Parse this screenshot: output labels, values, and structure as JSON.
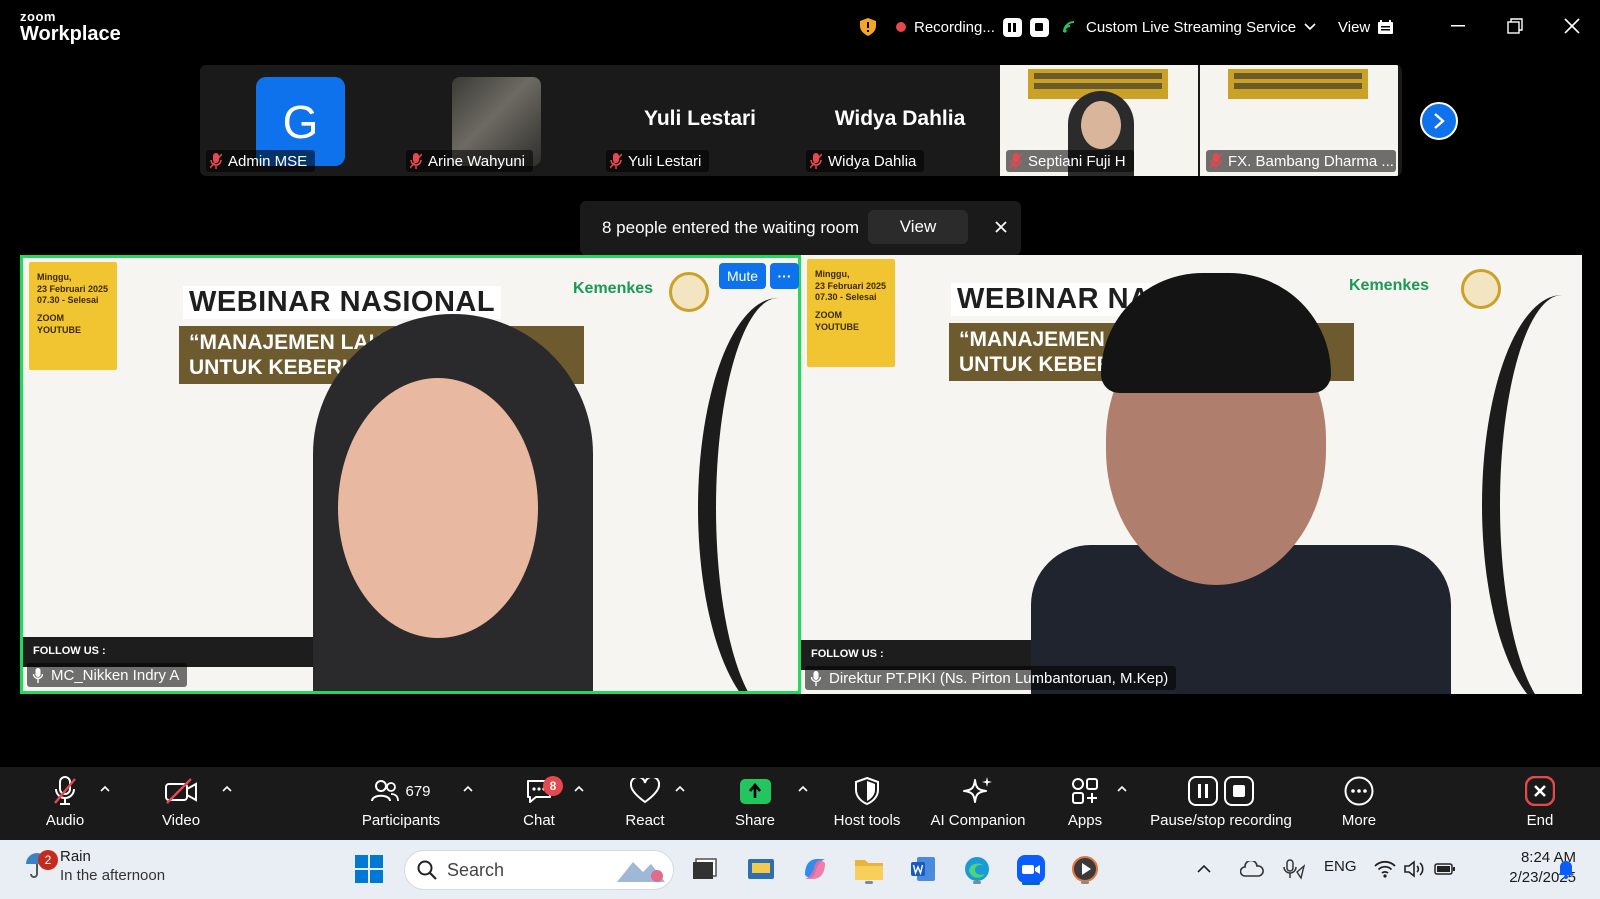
{
  "app": {
    "logo_line1": "zoom",
    "logo_line2": "Workplace"
  },
  "titlebar": {
    "recording_label": "Recording...",
    "streaming_label": "Custom Live Streaming Service",
    "view_label": "View"
  },
  "strip": {
    "tiles": [
      {
        "avatar_letter": "G",
        "name": "Admin MSE"
      },
      {
        "name": "Arine Wahyuni"
      },
      {
        "display_name": "Yuli Lestari",
        "name": "Yuli Lestari"
      },
      {
        "display_name": "Widya Dahlia",
        "name": "Widya Dahlia"
      },
      {
        "name": "Septiani Fuji H"
      },
      {
        "name": "FX. Bambang Dharma ..."
      }
    ]
  },
  "waiting_room": {
    "message": "8 people entered the waiting room",
    "view_label": "View"
  },
  "main_videos": [
    {
      "name": "MC_Nikken Indry A",
      "mute_label": "Mute",
      "more_label": "···",
      "poster": {
        "date_lines": [
          "Minggu,",
          "23 Februari 2025",
          "07.30 - Selesai",
          "ZOOM",
          "YOUTUBE"
        ],
        "title": "WEBINAR NASIONAL",
        "subtitle_line1": "“MANAJEMEN LAKTA     ONSELING",
        "subtitle_line2": "UNTUK KEBERHA              I”",
        "brand": "Kemenkes",
        "follow": "FOLLOW US :"
      }
    },
    {
      "name": "Direktur PT.PIKI (Ns. Pirton Lumbantoruan, M.Kep)",
      "poster": {
        "date_lines": [
          "Minggu,",
          "23 Februari 2025",
          "07.30 - Selesai",
          "ZOOM",
          "YOUTUBE"
        ],
        "title": "WEBINAR NASI",
        "subtitle_line1": "“MANAJEMEN LA           LING",
        "subtitle_line2": "UNTUK KEBERH   SILAN     SUI”",
        "brand": "Kemenkes",
        "follow": "FOLLOW US :"
      }
    }
  ],
  "toolbar": {
    "audio": "Audio",
    "video": "Video",
    "participants": "Participants",
    "participants_count": "679",
    "chat": "Chat",
    "chat_badge": "8",
    "react": "React",
    "share": "Share",
    "host_tools": "Host tools",
    "ai_companion": "AI Companion",
    "apps": "Apps",
    "pause_stop": "Pause/stop recording",
    "more": "More",
    "end": "End"
  },
  "taskbar": {
    "weather_badge": "2",
    "weather_title": "Rain",
    "weather_sub": "In the afternoon",
    "search_placeholder": "Search",
    "lang": "ENG",
    "time": "8:24 AM",
    "date": "2/23/2025"
  },
  "colors": {
    "accent": "#0e72ed",
    "active_speaker": "#23d959",
    "recording": "#e5484d",
    "share": "#23c55e"
  }
}
